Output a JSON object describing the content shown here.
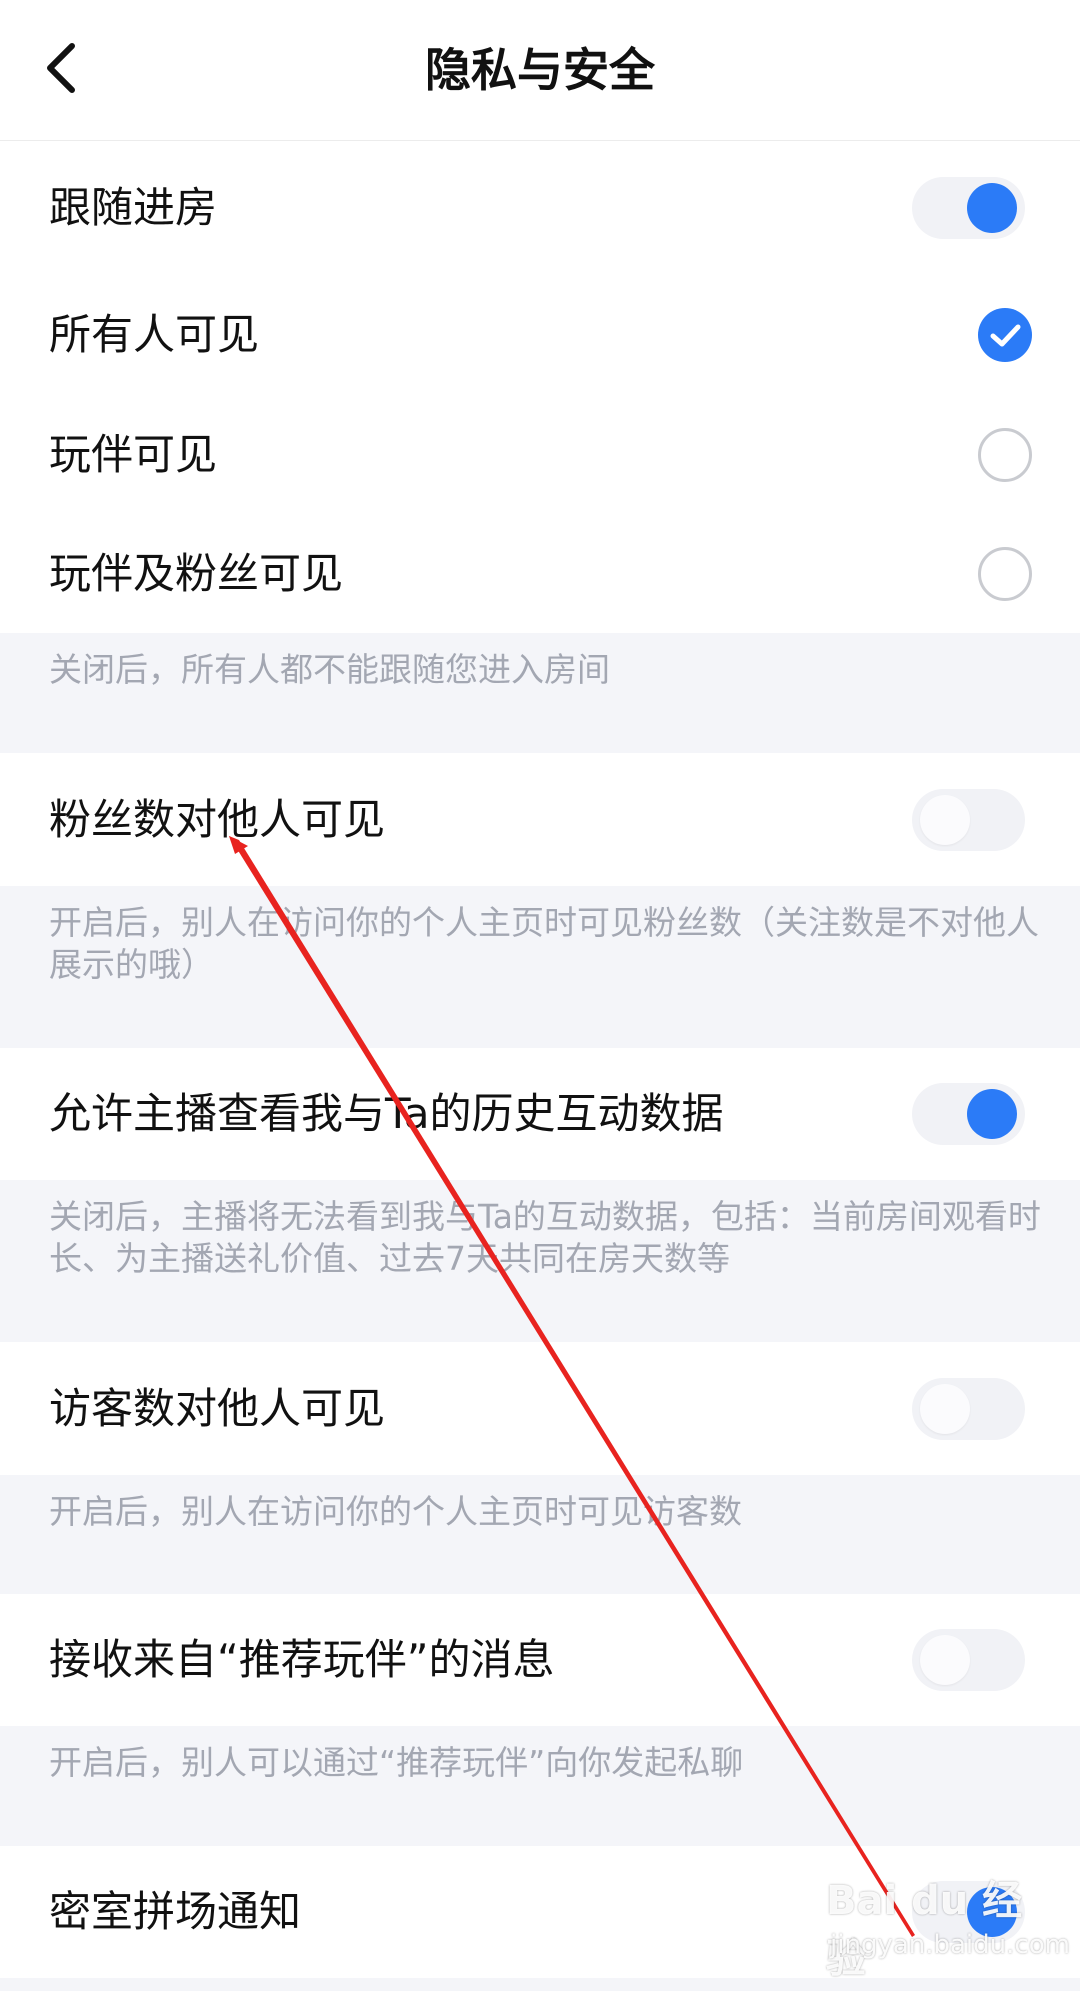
{
  "header": {
    "title": "隐私与安全",
    "back_icon": "back-arrow-icon"
  },
  "follow": {
    "label": "跟随进房",
    "toggle_on": true,
    "options": [
      {
        "label": "所有人可见",
        "selected": true
      },
      {
        "label": "玩伴可见",
        "selected": false
      },
      {
        "label": "玩伴及粉丝可见",
        "selected": false
      }
    ],
    "note": "关闭后，所有人都不能跟随您进入房间"
  },
  "fans_visible": {
    "label": "粉丝数对他人可见",
    "toggle_on": false,
    "note": "开启后，别人在访问你的个人主页时可见粉丝数（关注数是不对他人展示的哦）"
  },
  "host_history": {
    "label": "允许主播查看我与Ta的历史互动数据",
    "toggle_on": true,
    "note": "关闭后，主播将无法看到我与Ta的互动数据，包括：当前房间观看时长、为主播送礼价值、过去7天共同在房天数等"
  },
  "visitors_visible": {
    "label": "访客数对他人可见",
    "toggle_on": false,
    "note": "开启后，别人在访问你的个人主页时可见访客数"
  },
  "recommend_msg": {
    "label": "接收来自“推荐玩伴”的消息",
    "toggle_on": false,
    "note": "开启后，别人可以通过“推荐玩伴”向你发起私聊"
  },
  "escape_room": {
    "label": "密室拼场通知",
    "toggle_on": true
  },
  "watermark": {
    "brand": "Bai du 经验",
    "url": "jingyan.baidu.com"
  },
  "colors": {
    "accent": "#2b7bf7",
    "note_bg": "#f4f5f9",
    "note_text": "#a3a7b2",
    "annotation": "#e8231f"
  }
}
